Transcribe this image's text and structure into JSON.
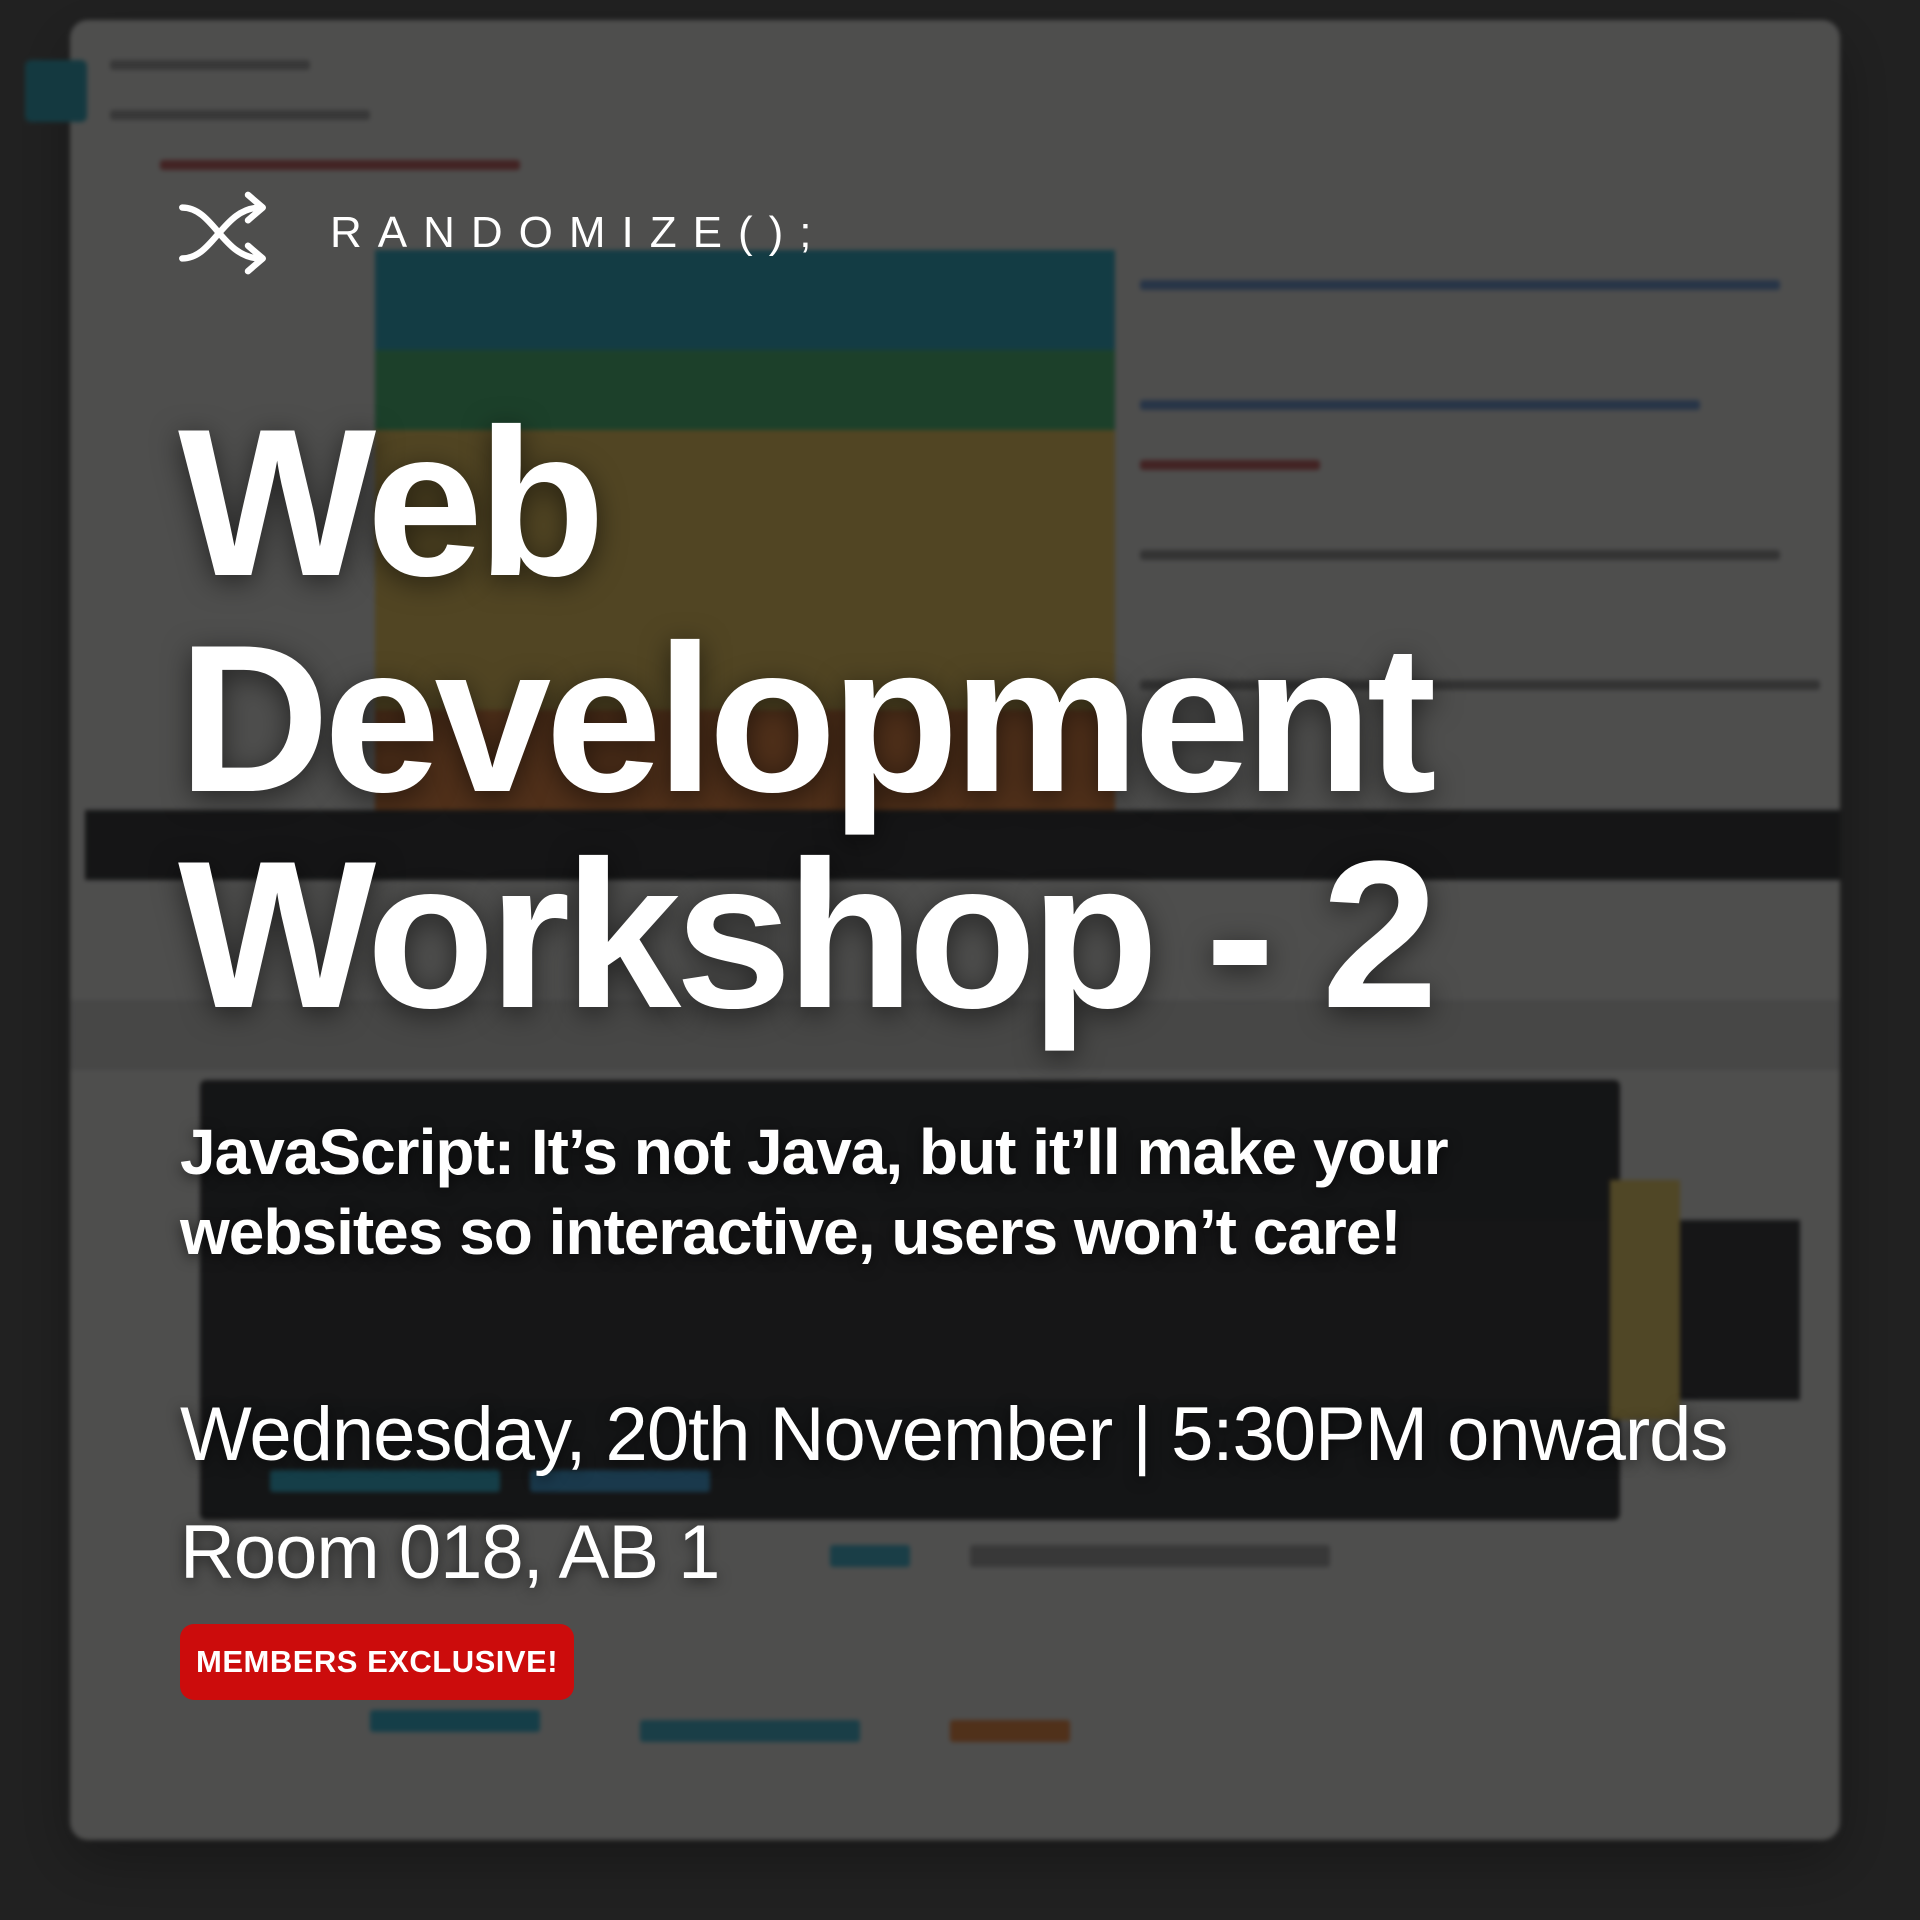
{
  "brand": {
    "logo_icon": "shuffle-arrows-icon",
    "name": "RANDOMIZE();"
  },
  "title": {
    "line1": "Web",
    "line2": "Development",
    "line3": "Workshop - 2"
  },
  "subtitle": "JavaScript: It’s not Java, but it’ll make your websites so interactive, users won’t care!",
  "event": {
    "date_time": "Wednesday, 20th November | 5:30PM onwards",
    "location": "Room 018, AB 1"
  },
  "badge": {
    "label": "MEMBERS EXCLUSIVE!",
    "color": "#cc0c0c"
  },
  "colors": {
    "text": "#ffffff",
    "overlay": "#121212"
  }
}
